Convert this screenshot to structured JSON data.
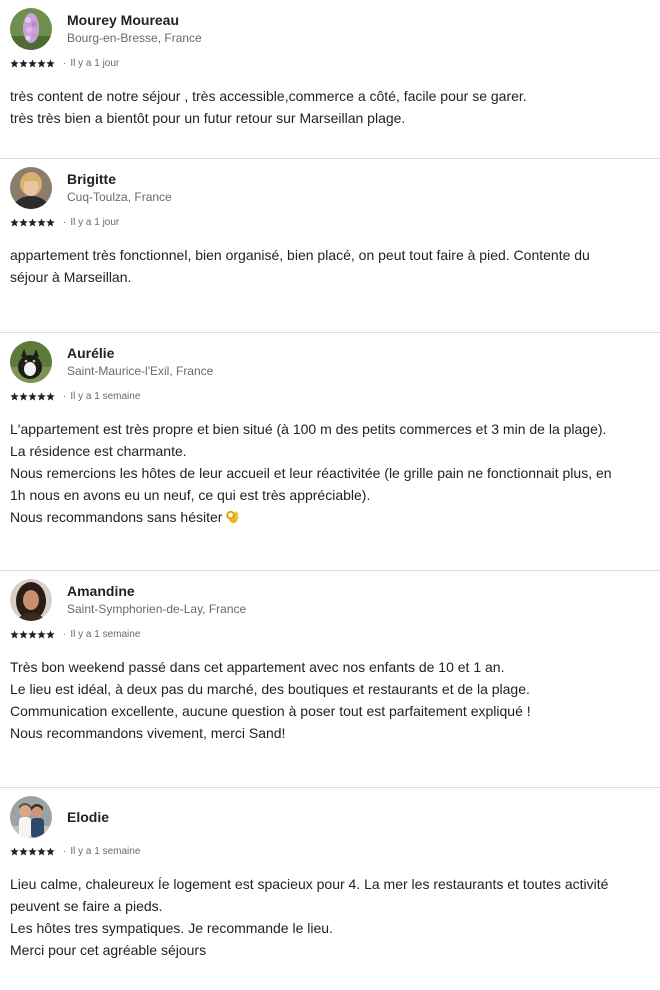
{
  "colors": {
    "text": "#222222",
    "secondary": "#6a6a6a",
    "divider": "#dddddd"
  },
  "reviews": [
    {
      "name": "Mourey Moureau",
      "location": "Bourg-en-Bresse, France",
      "rating": 5,
      "time": "Il y a 1 jour",
      "avatar_icon": "flower-photo",
      "lines": [
        "très content de notre séjour , très accessible,commerce a côté, facile pour se garer.",
        "très très bien a bientôt pour un futur retour sur Marseillan plage."
      ]
    },
    {
      "name": "Brigitte",
      "location": "Cuq-Toulza, France",
      "rating": 5,
      "time": "Il y a 1 jour",
      "avatar_icon": "person-photo",
      "lines": [
        "appartement très fonctionnel, bien organisé, bien placé, on peut tout faire à pied. Contente du",
        "séjour à Marseillan."
      ]
    },
    {
      "name": "Aurélie",
      "location": "Saint-Maurice-l'Exil, France",
      "rating": 5,
      "time": "Il y a 1 semaine",
      "avatar_icon": "cat-photo",
      "lines": [
        "L'appartement est très propre et bien situé (à 100 m des petits commerces et 3 min de la plage).",
        "La résidence est charmante.",
        "Nous remercions les hôtes de leur accueil et leur réactivitée (le grille pain ne fonctionnait plus, en",
        "1h nous en avons eu un neuf, ce qui est très appréciable).",
        "Nous recommandons sans hésiter"
      ],
      "emoji_icon": "ok-hand-emoji"
    },
    {
      "name": "Amandine",
      "location": "Saint-Symphorien-de-Lay, France",
      "rating": 5,
      "time": "Il y a 1 semaine",
      "avatar_icon": "person-photo",
      "lines": [
        "Très bon weekend passé dans cet appartement avec nos enfants de 10 et 1 an.",
        "Le lieu est idéal, à deux pas du marché, des boutiques et restaurants et de la plage.",
        "Communication excellente, aucune question à poser tout est parfaitement expliqué !",
        "Nous recommandons vivement, merci Sand!"
      ]
    },
    {
      "name": "Elodie",
      "location": "",
      "rating": 5,
      "time": "Il y a 1 semaine",
      "avatar_icon": "couple-photo",
      "lines": [
        "Lieu calme, chaleureux Íe logement est spacieux pour 4. La mer les restaurants et toutes activité",
        "peuvent se faire a pieds.",
        "Les hôtes tres sympatiques. Je recommande le lieu.",
        "Merci pour cet agréable séjours"
      ]
    }
  ]
}
